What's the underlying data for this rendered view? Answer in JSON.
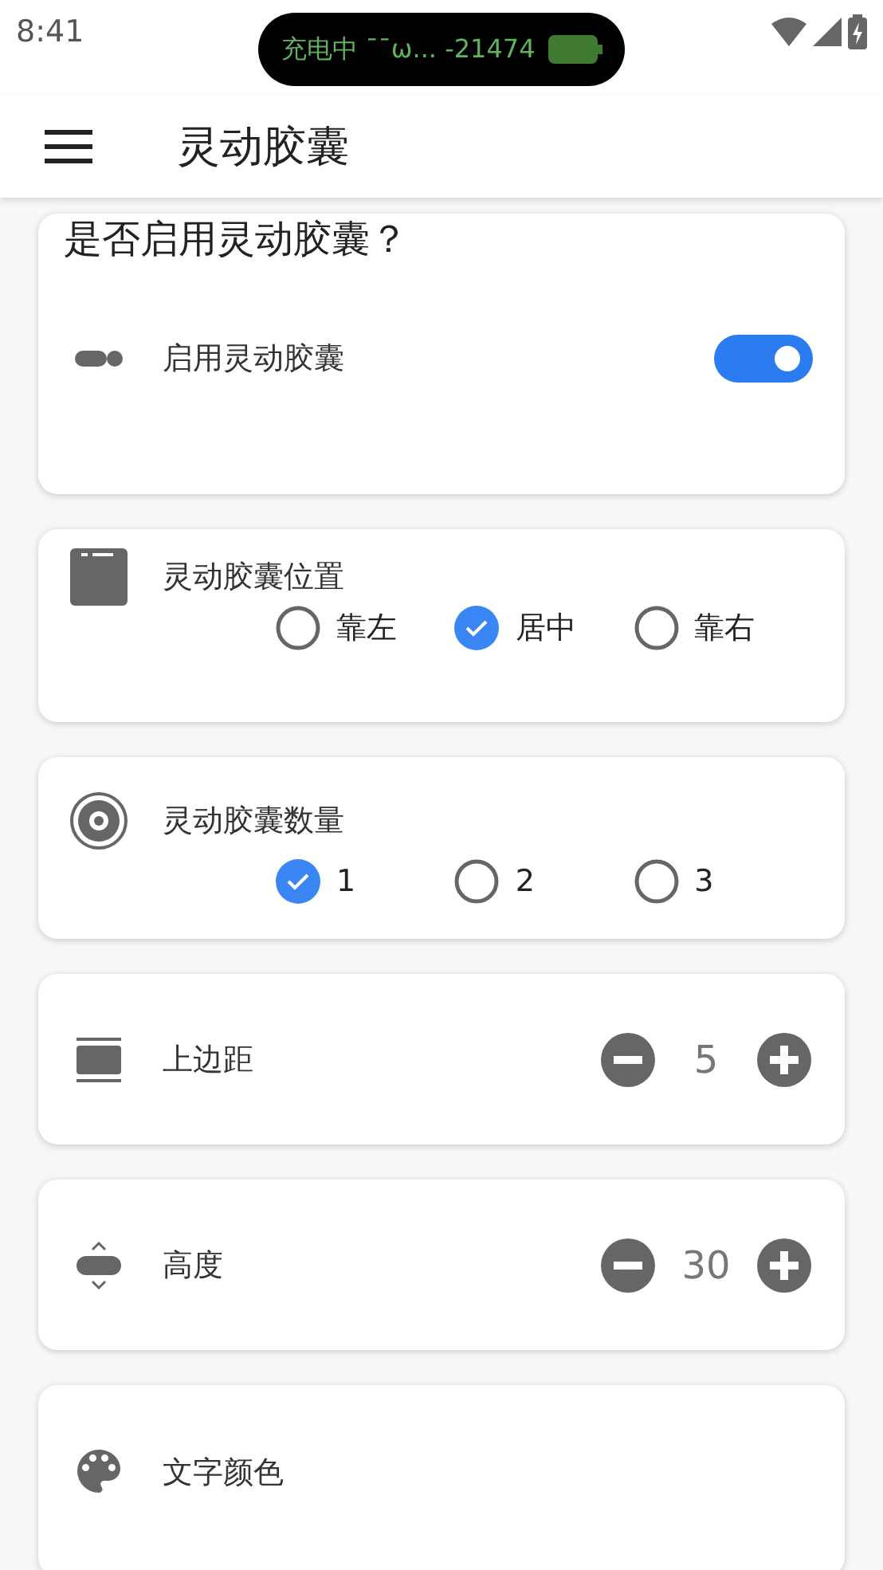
{
  "status_bar": {
    "time": "8:41",
    "pill_text": "充电中 ¯¯ω... -21474"
  },
  "app_bar": {
    "title": "灵动胶囊"
  },
  "cards": [
    {
      "kind": "toggle",
      "heading": "是否启用灵动胶囊？",
      "label": "启用灵动胶囊",
      "on": true
    },
    {
      "kind": "radio",
      "label": "灵动胶囊位置",
      "options": [
        {
          "label": "靠左",
          "selected": false
        },
        {
          "label": "居中",
          "selected": true
        },
        {
          "label": "靠右",
          "selected": false
        }
      ]
    },
    {
      "kind": "radio",
      "label": "灵动胶囊数量",
      "options": [
        {
          "label": "1",
          "selected": true
        },
        {
          "label": "2",
          "selected": false
        },
        {
          "label": "3",
          "selected": false
        }
      ]
    },
    {
      "kind": "stepper",
      "label": "上边距",
      "value": "5"
    },
    {
      "kind": "stepper",
      "label": "高度",
      "value": "30"
    },
    {
      "kind": "plain",
      "label": "文字颜色"
    }
  ]
}
